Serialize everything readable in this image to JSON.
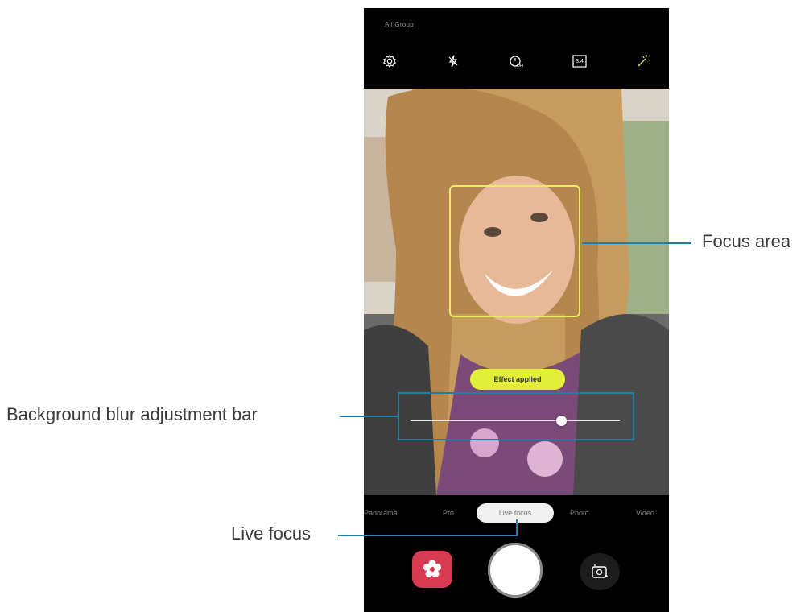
{
  "status_bar": {
    "text": "All Group"
  },
  "top_controls": [
    {
      "icon": "gear-icon"
    },
    {
      "icon": "flash-off-icon"
    },
    {
      "icon": "timer-off-icon"
    },
    {
      "icon": "aspect-ratio-icon",
      "label": "3:4"
    },
    {
      "icon": "effects-icon"
    }
  ],
  "effect_badge": "Effect applied",
  "modes": [
    "Panorama",
    "Pro",
    "Live focus",
    "Photo",
    "Video"
  ],
  "active_mode": "Live focus",
  "callouts": {
    "focus_area": "Focus area",
    "blur_bar": "Background blur adjustment bar",
    "live_focus": "Live focus"
  },
  "colors": {
    "focus_box": "#e9ec5d",
    "callout": "#1b7fa8",
    "filter_button": "#d83a52",
    "effect_pill": "#e2ef3a"
  },
  "blur_level": 0.72
}
